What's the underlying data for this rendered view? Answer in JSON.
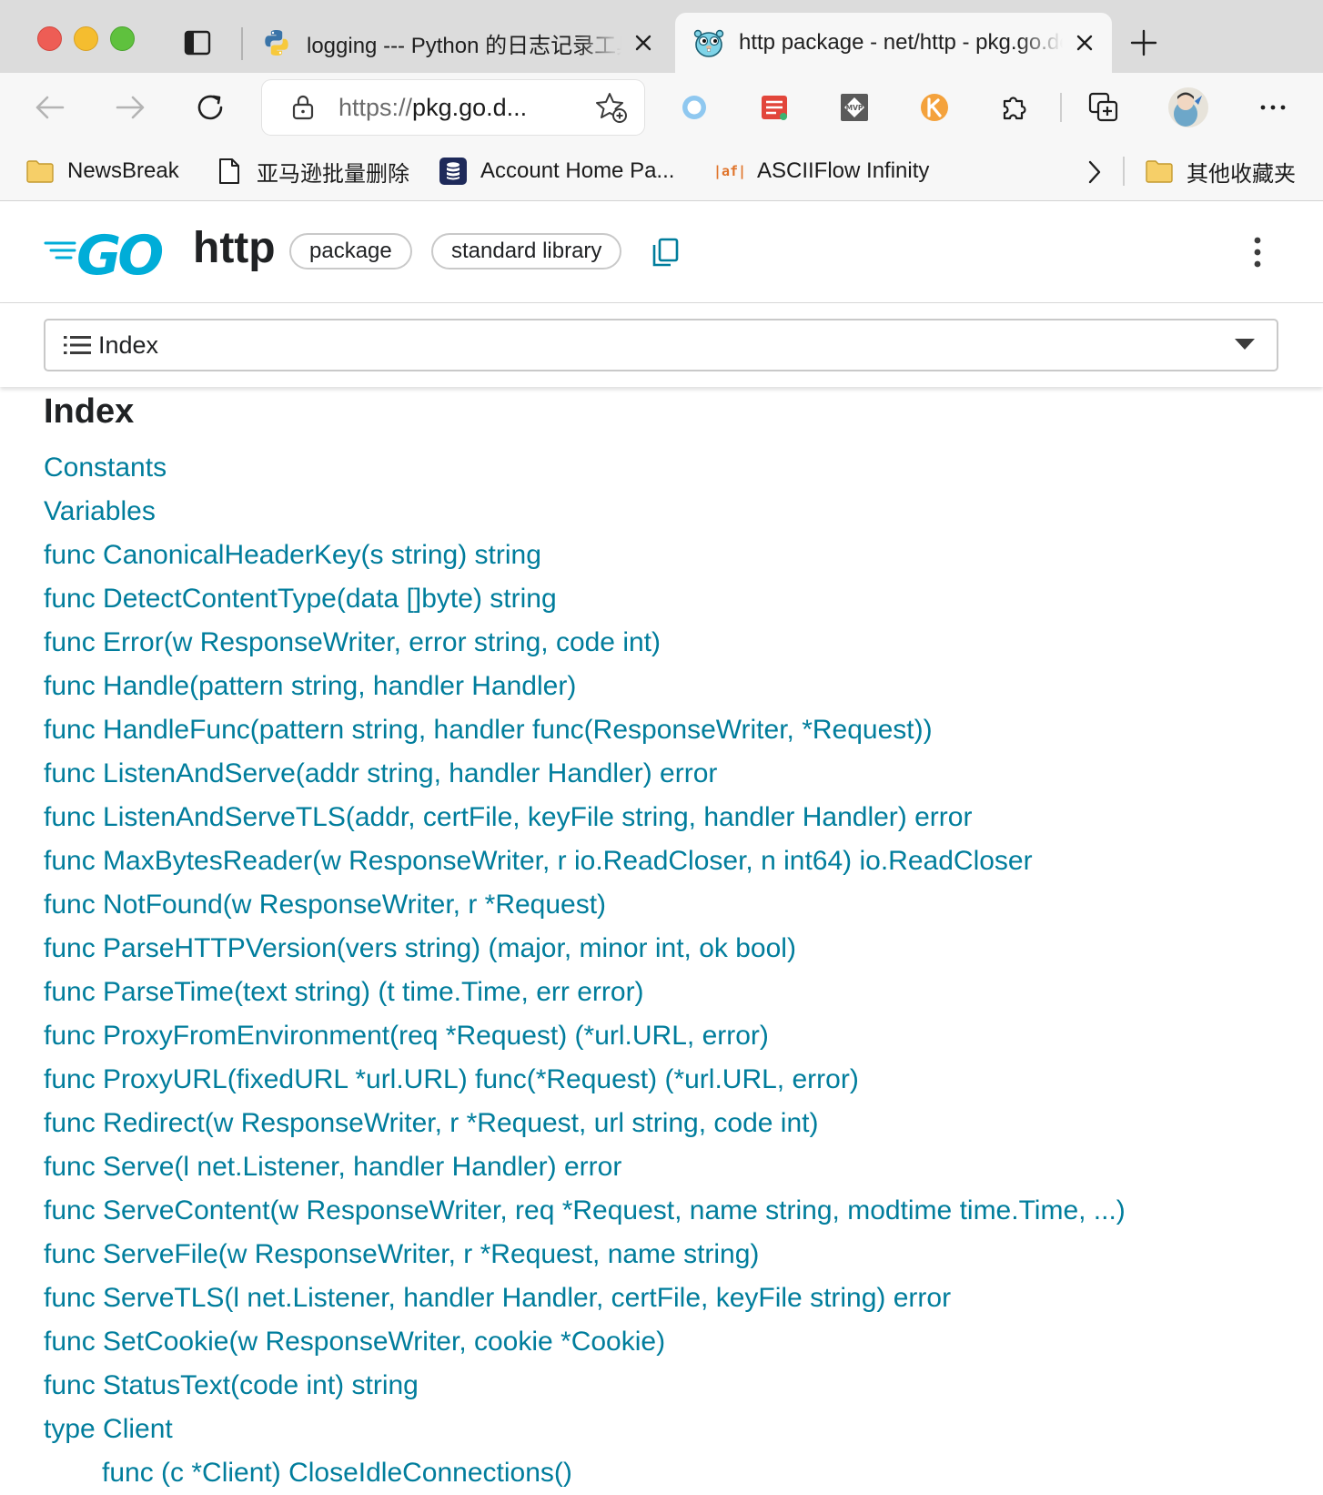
{
  "browser": {
    "tabs": [
      {
        "title": "logging --- Python 的日志记录工具",
        "icon": "python-icon",
        "active": false
      },
      {
        "title": "http package - net/http - pkg.go.dev",
        "icon": "gopher-icon",
        "active": true
      }
    ],
    "address": {
      "scheme": "https://",
      "host": "pkg.go.d..."
    },
    "bookmarks": [
      {
        "label": "NewsBreak",
        "icon": "folder-icon"
      },
      {
        "label": "亚马逊批量删除",
        "icon": "page-icon"
      },
      {
        "label": "Account Home Pa...",
        "icon": "database-icon"
      },
      {
        "label": "ASCIIFlow Infinity",
        "icon": "asciiflow-icon",
        "icon_text": "|af|"
      },
      {
        "label": "其他收藏夹",
        "icon": "folder-icon"
      }
    ],
    "extensions": {
      "mvp_text": "MVP"
    }
  },
  "header": {
    "logo_text": "GO",
    "title": "http",
    "chips": [
      "package",
      "standard library"
    ]
  },
  "index_select": {
    "label": "Index"
  },
  "content": {
    "heading": "Index",
    "items": [
      {
        "text": "Constants",
        "sub": false
      },
      {
        "text": "Variables",
        "sub": false
      },
      {
        "text": "func CanonicalHeaderKey(s string) string",
        "sub": false
      },
      {
        "text": "func DetectContentType(data []byte) string",
        "sub": false
      },
      {
        "text": "func Error(w ResponseWriter, error string, code int)",
        "sub": false
      },
      {
        "text": "func Handle(pattern string, handler Handler)",
        "sub": false
      },
      {
        "text": "func HandleFunc(pattern string, handler func(ResponseWriter, *Request))",
        "sub": false
      },
      {
        "text": "func ListenAndServe(addr string, handler Handler) error",
        "sub": false
      },
      {
        "text": "func ListenAndServeTLS(addr, certFile, keyFile string, handler Handler) error",
        "sub": false
      },
      {
        "text": "func MaxBytesReader(w ResponseWriter, r io.ReadCloser, n int64) io.ReadCloser",
        "sub": false
      },
      {
        "text": "func NotFound(w ResponseWriter, r *Request)",
        "sub": false
      },
      {
        "text": "func ParseHTTPVersion(vers string) (major, minor int, ok bool)",
        "sub": false
      },
      {
        "text": "func ParseTime(text string) (t time.Time, err error)",
        "sub": false
      },
      {
        "text": "func ProxyFromEnvironment(req *Request) (*url.URL, error)",
        "sub": false
      },
      {
        "text": "func ProxyURL(fixedURL *url.URL) func(*Request) (*url.URL, error)",
        "sub": false
      },
      {
        "text": "func Redirect(w ResponseWriter, r *Request, url string, code int)",
        "sub": false
      },
      {
        "text": "func Serve(l net.Listener, handler Handler) error",
        "sub": false
      },
      {
        "text": "func ServeContent(w ResponseWriter, req *Request, name string, modtime time.Time, ...)",
        "sub": false
      },
      {
        "text": "func ServeFile(w ResponseWriter, r *Request, name string)",
        "sub": false
      },
      {
        "text": "func ServeTLS(l net.Listener, handler Handler, certFile, keyFile string) error",
        "sub": false
      },
      {
        "text": "func SetCookie(w ResponseWriter, cookie *Cookie)",
        "sub": false
      },
      {
        "text": "func StatusText(code int) string",
        "sub": false
      },
      {
        "text": "type Client",
        "sub": false
      },
      {
        "text": "func (c *Client) CloseIdleConnections()",
        "sub": true
      }
    ]
  },
  "colors": {
    "link": "#007d9c",
    "go_blue": "#00add8",
    "text": "#202224"
  }
}
